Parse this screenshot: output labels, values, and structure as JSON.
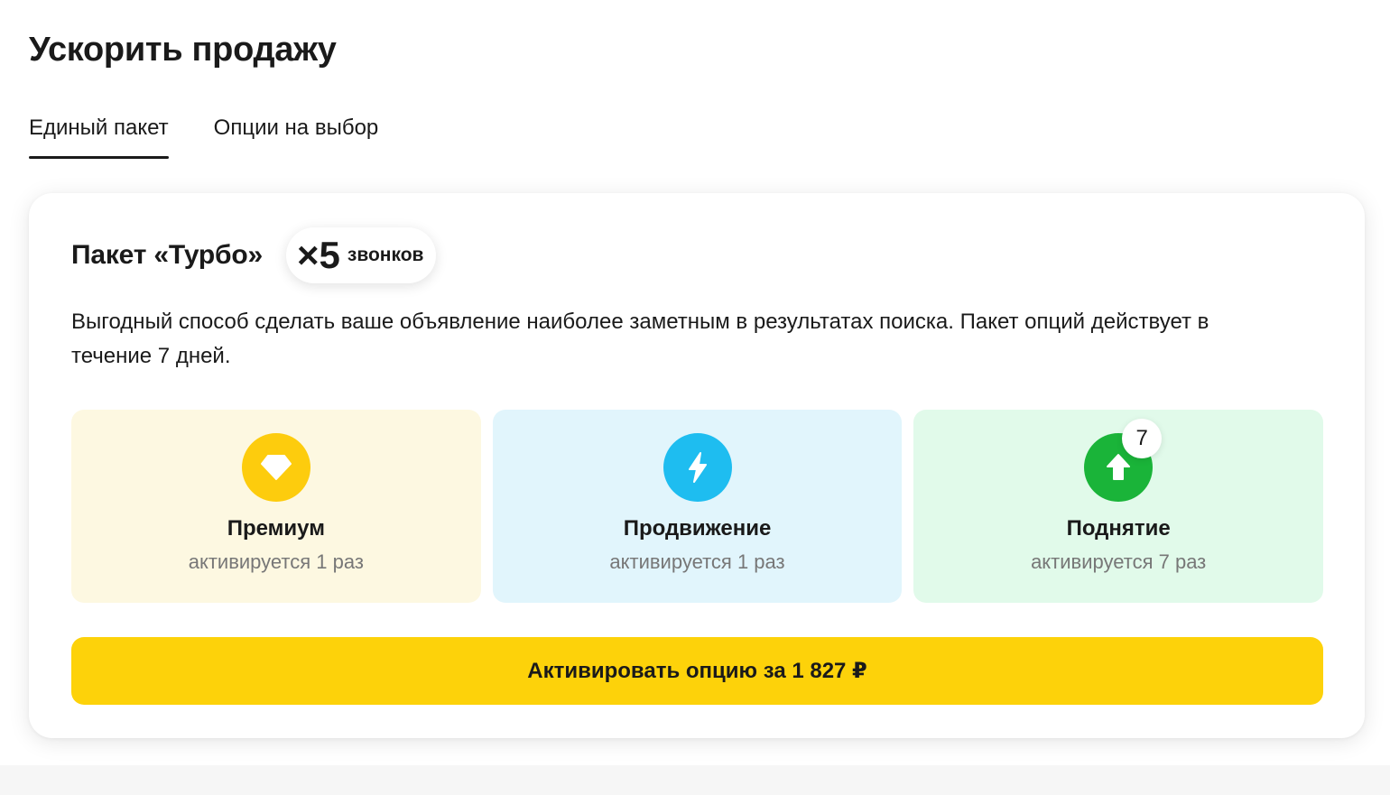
{
  "page": {
    "title": "Ускорить продажу"
  },
  "tabs": [
    {
      "label": "Единый пакет",
      "active": true
    },
    {
      "label": "Опции на выбор",
      "active": false
    }
  ],
  "package": {
    "title": "Пакет «Турбо»",
    "multiplier": {
      "value": "×5",
      "unit": "звонков"
    },
    "description": "Выгодный способ сделать ваше объявление наиболее заметным в результатах поиска. Пакет опций действует в течение 7 дней.",
    "options": [
      {
        "name": "Премиум",
        "subtitle": "активируется 1 раз",
        "icon": "diamond-icon",
        "color": "#fdcc0d",
        "background": "#fdf8e1"
      },
      {
        "name": "Продвижение",
        "subtitle": "активируется 1 раз",
        "icon": "lightning-icon",
        "color": "#1ebdf0",
        "background": "#e1f5fc"
      },
      {
        "name": "Поднятие",
        "subtitle": "активируется 7 раз",
        "icon": "arrow-up-icon",
        "color": "#1ab439",
        "background": "#e1faea",
        "badge": "7"
      }
    ],
    "cta": {
      "label": "Активировать опцию за 1 827 ₽",
      "color": "#fdd20a"
    }
  }
}
